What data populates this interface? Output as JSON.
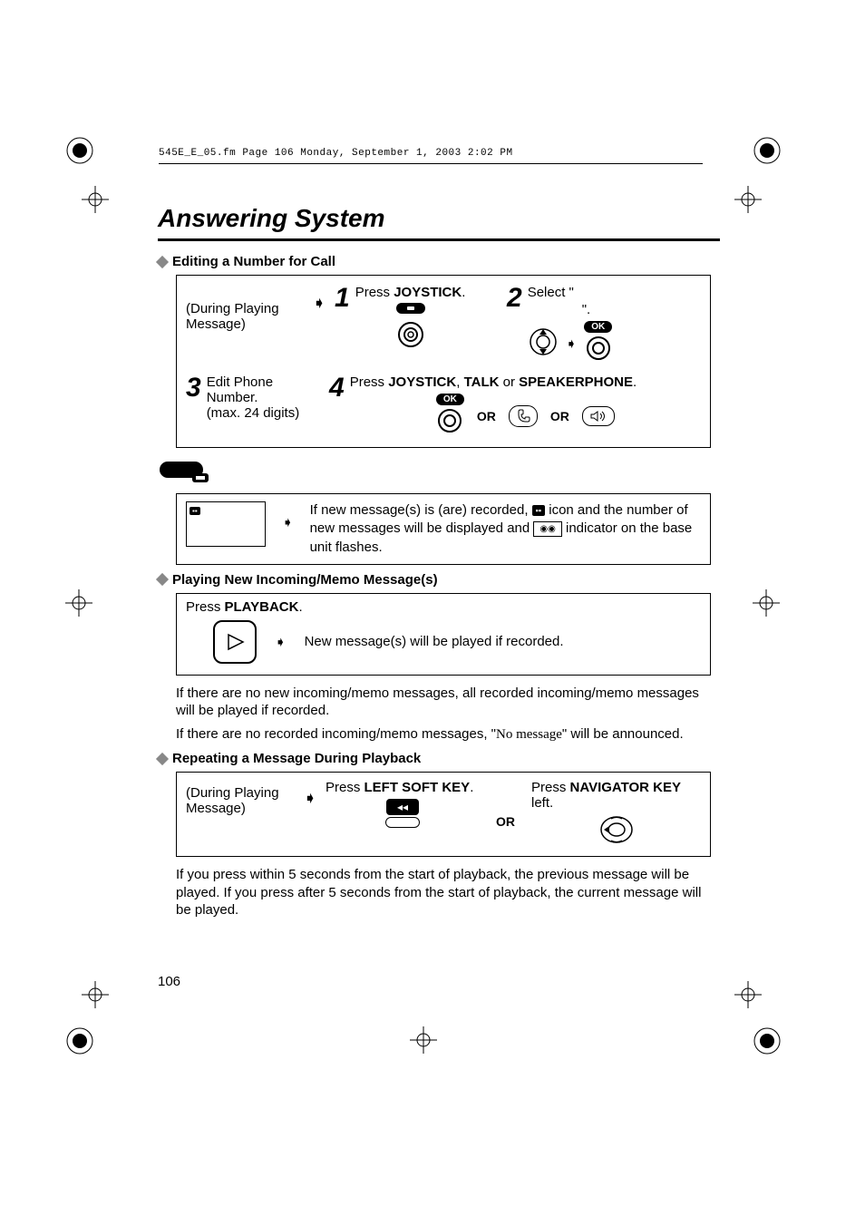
{
  "header": "545E_E_05.fm  Page 106  Monday, September 1, 2003  2:02 PM",
  "title": "Answering System",
  "page_number": "106",
  "section_edit": {
    "heading": "Editing a Number for Call",
    "during": "(During Playing Message)",
    "step1_text": "Press ",
    "step1_bold": "JOYSTICK",
    "step1_after": ".",
    "step2_text": "Select \"",
    "step2_after": "\".",
    "step3_line1": "Edit Phone",
    "step3_line2": "Number.",
    "step3_line3": "(max. 24 digits)",
    "step4_pre": "Press ",
    "step4_b1": "JOYSTICK",
    "step4_mid1": ", ",
    "step4_b2": "TALK",
    "step4_mid2": " or ",
    "step4_b3": "SPEAKERPHONE",
    "step4_after": ".",
    "or": "OR",
    "ok": "OK"
  },
  "newmsg": {
    "text_a": "If new message(s) is (are) recorded, ",
    "text_b": " icon and the number of new messages will be displayed and ",
    "text_c": " indicator on the base unit flashes."
  },
  "section_play": {
    "heading": "Playing New Incoming/Memo Message(s)",
    "press": "Press ",
    "playback": "PLAYBACK",
    "after": ".",
    "bullet": "New message(s) will be played if recorded.",
    "para1": "If there are no new incoming/memo messages, all recorded incoming/memo messages will be played if recorded.",
    "para2a": "If there are no recorded incoming/memo messages, \"",
    "para2b": "No message",
    "para2c": "\" will be announced."
  },
  "section_repeat": {
    "heading": "Repeating a Message During Playback",
    "during": "(During Playing Message)",
    "left_pre": "Press ",
    "left_bold": "LEFT SOFT KEY",
    "left_after": ".",
    "or": "OR",
    "nav_pre": "Press ",
    "nav_bold": "NAVIGATOR KEY",
    "nav_after": " left.",
    "para": "If you press within 5 seconds from the start of playback, the previous message will be played. If you press after 5 seconds from the start of playback, the current message will be played."
  }
}
